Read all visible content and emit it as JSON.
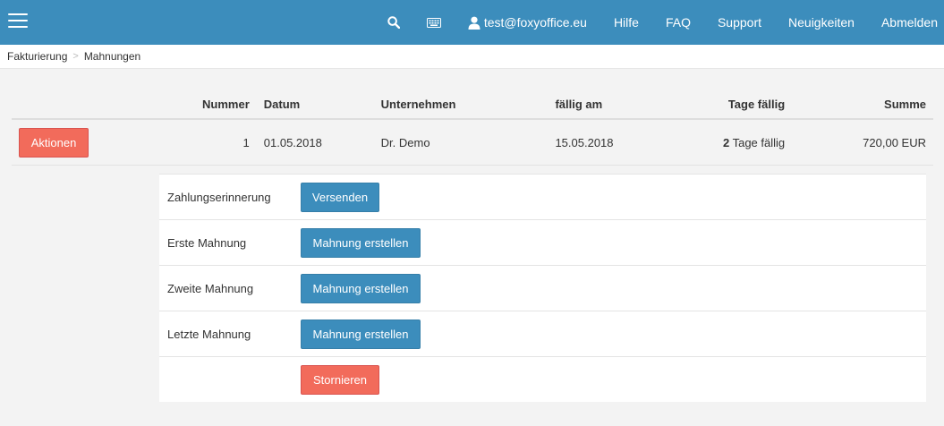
{
  "topbar": {
    "user_email": "test@foxyoffice.eu",
    "links": [
      "Hilfe",
      "FAQ",
      "Support",
      "Neuigkeiten",
      "Abmelden"
    ],
    "color": "#3c8dbc"
  },
  "breadcrumb": {
    "items": [
      "Fakturierung",
      "Mahnungen"
    ],
    "separator": ">"
  },
  "table": {
    "headers": {
      "nummer": "Nummer",
      "datum": "Datum",
      "unternehmen": "Unternehmen",
      "faellig_am": "fällig am",
      "tage_faellig": "Tage fällig",
      "summe": "Summe"
    },
    "rows": [
      {
        "action_label": "Aktionen",
        "nummer": "1",
        "datum": "01.05.2018",
        "unternehmen": "Dr. Demo",
        "faellig_am": "15.05.2018",
        "tage_count": "2",
        "tage_suffix": "Tage fällig",
        "summe": "720,00 EUR"
      }
    ]
  },
  "actions_panel": {
    "rows": [
      {
        "label": "Zahlungserinnerung",
        "button": "Versenden"
      },
      {
        "label": "Erste Mahnung",
        "button": "Mahnung erstellen"
      },
      {
        "label": "Zweite Mahnung",
        "button": "Mahnung erstellen"
      },
      {
        "label": "Letzte Mahnung",
        "button": "Mahnung erstellen"
      },
      {
        "label": "",
        "button": "Stornieren"
      }
    ]
  }
}
